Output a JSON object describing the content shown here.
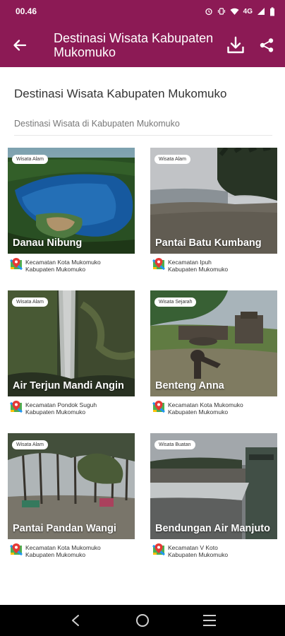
{
  "status_bar": {
    "time": "00.46",
    "network": "4G"
  },
  "app_bar": {
    "title": "Destinasi Wisata Kabupaten Mukomuko"
  },
  "page": {
    "heading": "Destinasi Wisata Kabupaten Mukomuko",
    "subheading": "Destinasi Wisata di Kabupaten Mukomuko"
  },
  "cards": [
    {
      "badge": "Wisata Alam",
      "name": "Danau Nibung",
      "district": "Kecamatan Kota Mukomuko",
      "regency": "Kabupaten Mukomuko"
    },
    {
      "badge": "Wisata Alam",
      "name": "Pantai Batu Kumbang",
      "district": "Kecamatan Ipuh",
      "regency": "Kabupaten Mukomuko"
    },
    {
      "badge": "Wisata Alam",
      "name": "Air Terjun Mandi Angin",
      "district": "Kecamatan Pondok Suguh",
      "regency": "Kabupaten Mukomuko"
    },
    {
      "badge": "Wisata Sejarah",
      "name": "Benteng Anna",
      "district": "Kecamatan Kota Mukomuko",
      "regency": "Kabupaten Mukomuko"
    },
    {
      "badge": "Wisata Alam",
      "name": "Pantai Pandan Wangi",
      "district": "Kecamatan Kota Mukomuko",
      "regency": "Kabupaten Mukomuko"
    },
    {
      "badge": "Wisata Buatan",
      "name": "Bendungan Air Manjuto",
      "district": "Kecamatan V Koto",
      "regency": "Kabupaten Mukomuko"
    }
  ],
  "colors": {
    "brand": "#8c1a55"
  },
  "icons": [
    "back-arrow-icon",
    "download-icon",
    "share-icon",
    "location-pin-icon",
    "nav-back-icon",
    "nav-home-icon",
    "nav-recents-icon"
  ]
}
